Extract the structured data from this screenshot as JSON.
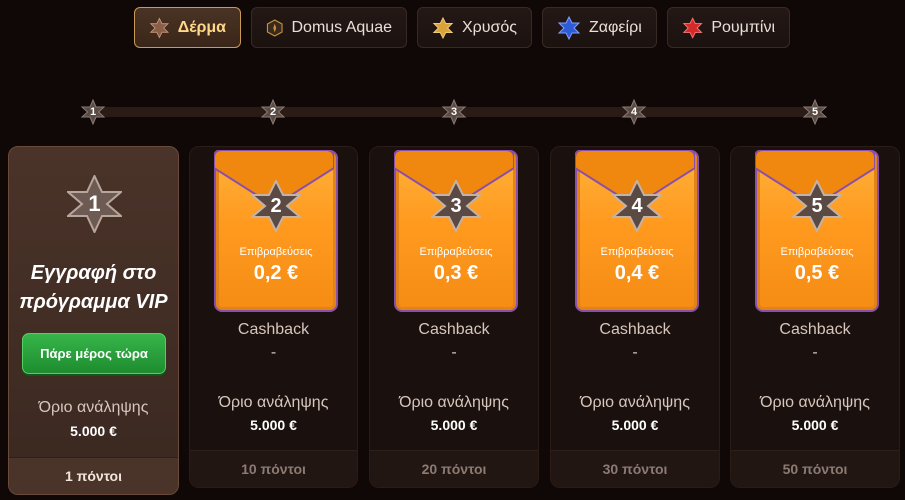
{
  "tabs": [
    {
      "label": "Δέρμα",
      "icon": "star-leather-icon",
      "color": "#8b5e48",
      "active": true
    },
    {
      "label": "Domus Aquae",
      "icon": "hexagon-badge-icon",
      "color": "#c9923e",
      "active": false
    },
    {
      "label": "Χρυσός",
      "icon": "star-gold-icon",
      "color": "#d9a23b",
      "active": false
    },
    {
      "label": "Ζαφείρι",
      "icon": "star-sapphire-icon",
      "color": "#2f5bd6",
      "active": false
    },
    {
      "label": "Ρουμπίνι",
      "icon": "star-ruby-icon",
      "color": "#d42a2a",
      "active": false
    }
  ],
  "levels": [
    "1",
    "2",
    "3",
    "4",
    "5"
  ],
  "first_card": {
    "level": "1",
    "title_line1": "Εγγραφή στο",
    "title_line2": "πρόγραμμα VIP",
    "cta_label": "Πάρε μέρος τώρα",
    "limit_label": "Όριο ανάληψης",
    "limit_value": "5.000 €",
    "points": "1 πόντοι"
  },
  "cards": [
    {
      "level": "2",
      "reward_label": "Επιβραβεύσεις",
      "reward_value": "0,2 €",
      "cashback_label": "Cashback",
      "cashback_value": "-",
      "limit_label": "Όριο ανάληψης",
      "limit_value": "5.000 €",
      "points": "10 πόντοι"
    },
    {
      "level": "3",
      "reward_label": "Επιβραβεύσεις",
      "reward_value": "0,3 €",
      "cashback_label": "Cashback",
      "cashback_value": "-",
      "limit_label": "Όριο ανάληψης",
      "limit_value": "5.000 €",
      "points": "20 πόντοι"
    },
    {
      "level": "4",
      "reward_label": "Επιβραβεύσεις",
      "reward_value": "0,4 €",
      "cashback_label": "Cashback",
      "cashback_value": "-",
      "limit_label": "Όριο ανάληψης",
      "limit_value": "5.000 €",
      "points": "30 πόντοι"
    },
    {
      "level": "5",
      "reward_label": "Επιβραβεύσεις",
      "reward_value": "0,5 €",
      "cashback_label": "Cashback",
      "cashback_value": "-",
      "limit_label": "Όριο ανάληψης",
      "limit_value": "5.000 €",
      "points": "50 πόντοι"
    }
  ],
  "colors": {
    "accent_gold": "#ffd88a",
    "cta_green": "#2aa33c",
    "envelope_orange": "#ff9a1f",
    "envelope_trim": "#8a4fa8"
  }
}
